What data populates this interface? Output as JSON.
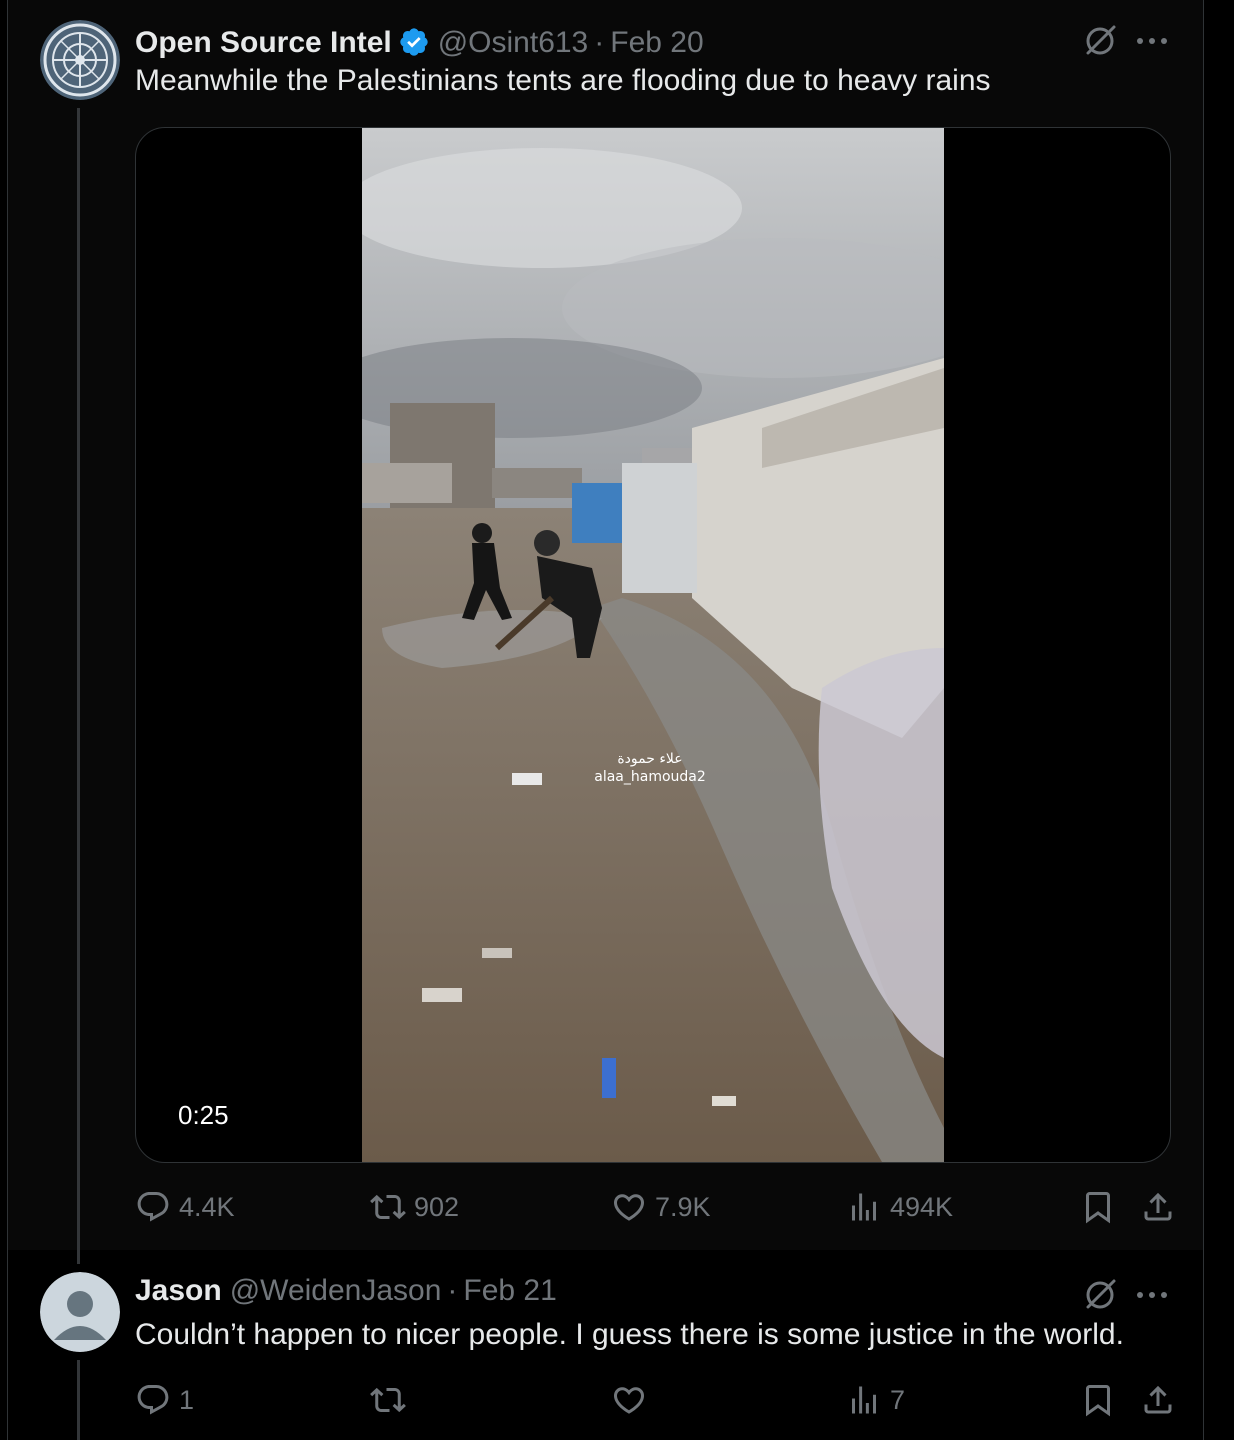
{
  "tweet": {
    "author_name": "Open Source Intel",
    "handle": "@Osint613",
    "separator": "·",
    "date": "Feb 20",
    "text": "Meanwhile the Palestinians tents are flooding due to heavy rains",
    "media": {
      "duration": "0:25",
      "watermark_arabic": "علاء حمودة",
      "watermark_handle": "alaa_hamouda2"
    },
    "actions": {
      "replies": "4.4K",
      "reposts": "902",
      "likes": "7.9K",
      "views": "494K"
    }
  },
  "reply": {
    "author_name": "Jason",
    "handle": "@WeidenJason",
    "separator": "·",
    "date": "Feb 21",
    "text": "Couldn’t happen to nicer people.  I guess there is some justice in the world.",
    "actions": {
      "replies": "1",
      "reposts": "",
      "likes": "",
      "views": "7"
    }
  },
  "icons": {
    "verified": "verified-badge-icon",
    "grok": "grok-icon",
    "more": "more-icon",
    "reply": "reply-icon",
    "repost": "repost-icon",
    "like": "like-icon",
    "views": "views-icon",
    "bookmark": "bookmark-icon",
    "share": "share-icon"
  },
  "colors": {
    "background": "#000000",
    "text": "#e7e9ea",
    "secondary": "#71767b",
    "verified": "#1d9bf0",
    "border": "#2f3336"
  }
}
